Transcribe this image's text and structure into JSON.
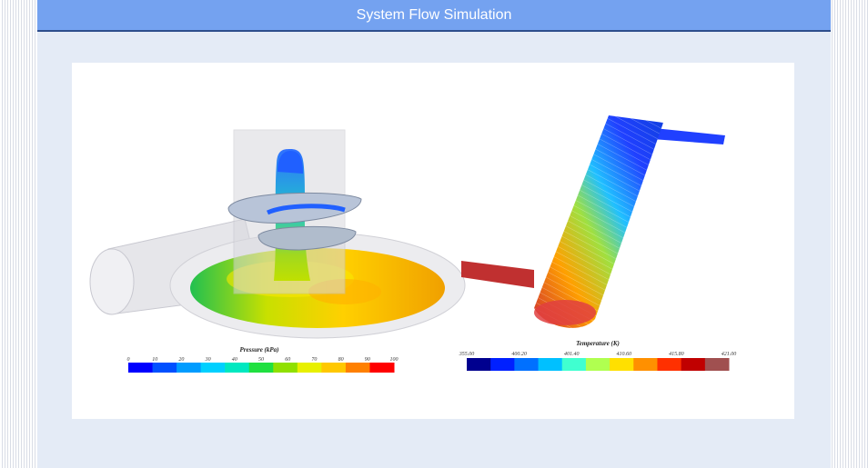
{
  "header": {
    "title": "System Flow Simulation"
  },
  "pressure_legend": {
    "title": "Pressure (kPa)",
    "ticks": [
      "0",
      "10",
      "20",
      "30",
      "40",
      "50",
      "60",
      "70",
      "80",
      "90",
      "100"
    ],
    "colors": [
      "#0000ff",
      "#0050ff",
      "#009cff",
      "#00d0ff",
      "#00e8c0",
      "#20e040",
      "#90e000",
      "#e8f000",
      "#ffc800",
      "#ff8000",
      "#ff0000"
    ]
  },
  "temperature_legend": {
    "title": "Temperature (K)",
    "ticks": [
      "355.00",
      "400.20",
      "401.40",
      "410.60",
      "415.80",
      "421.00"
    ],
    "colors": [
      "#00008f",
      "#0020ff",
      "#0070ff",
      "#00c0ff",
      "#40ffd0",
      "#b0ff50",
      "#ffe000",
      "#ff9000",
      "#ff3000",
      "#c00000",
      "#a05050"
    ]
  }
}
